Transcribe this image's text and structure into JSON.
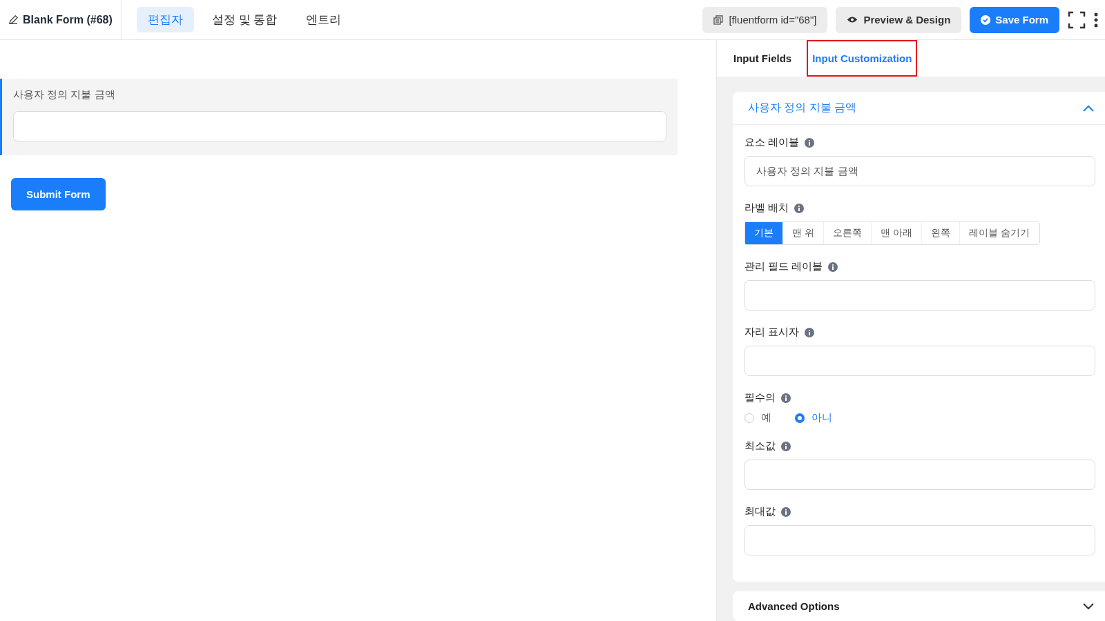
{
  "header": {
    "title": "Blank Form (#68)",
    "nav": [
      {
        "label": "편집자",
        "selected": true
      },
      {
        "label": "설정 및 통합",
        "selected": false
      },
      {
        "label": "엔트리",
        "selected": false
      }
    ],
    "shortcode": "[fluentform id=\"68\"]",
    "preview": "Preview & Design",
    "save": "Save Form"
  },
  "form": {
    "fields": [
      {
        "label": "사용자 정의 지불 금액",
        "selected": true
      }
    ],
    "submit": "Submit Form"
  },
  "sidebar": {
    "tabs": [
      {
        "label": "Input Fields",
        "selected": false,
        "highlighted": false
      },
      {
        "label": "Input Customization",
        "selected": true,
        "highlighted": true
      }
    ],
    "section": {
      "title": "사용자 정의 지불 금액",
      "expanded": true,
      "settings": [
        {
          "kind": "text",
          "label": "요소 레이블",
          "value": "사용자 정의 지불 금액"
        },
        {
          "kind": "segmented",
          "label": "라벨 배치",
          "options": [
            {
              "label": "기본",
              "selected": true
            },
            {
              "label": "맨 위",
              "selected": false
            },
            {
              "label": "오른쪽",
              "selected": false
            },
            {
              "label": "맨 아래",
              "selected": false
            },
            {
              "label": "왼쪽",
              "selected": false
            },
            {
              "label": "레이블 숨기기",
              "selected": false
            }
          ]
        },
        {
          "kind": "text",
          "label": "관리 필드 레이블"
        },
        {
          "kind": "text",
          "label": "자리 표시자"
        },
        {
          "kind": "radio",
          "label": "필수의",
          "options": [
            {
              "label": "예",
              "selected": false
            },
            {
              "label": "아니",
              "selected": true
            }
          ]
        },
        {
          "kind": "text",
          "label": "최소값"
        },
        {
          "kind": "text",
          "label": "최대값"
        }
      ]
    },
    "advanced": {
      "title": "Advanced Options",
      "expanded": false
    }
  }
}
